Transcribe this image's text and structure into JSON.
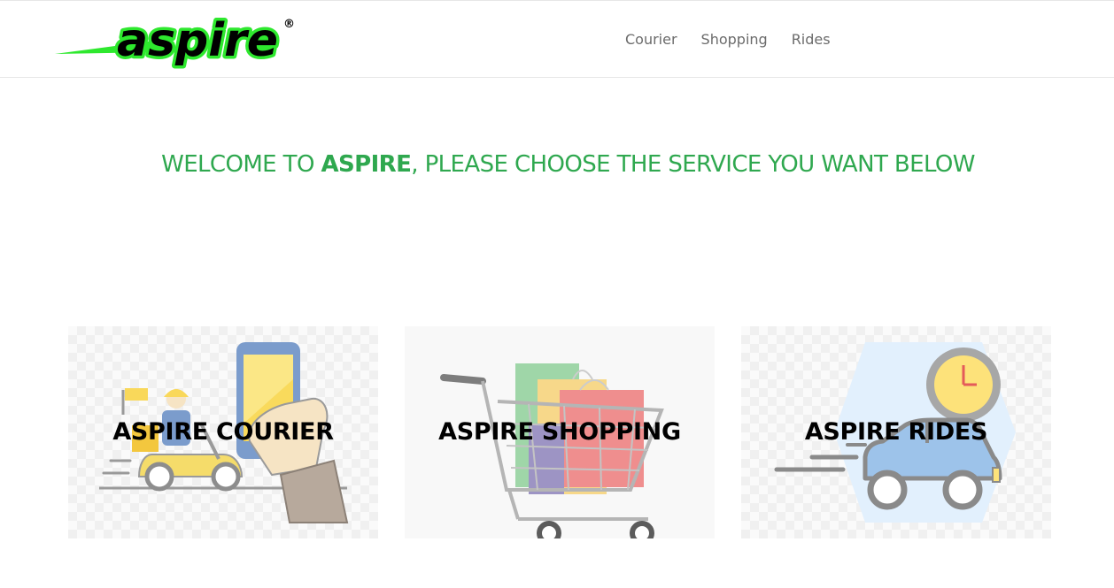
{
  "brand": {
    "logo_text": "aspire",
    "registered_mark": "®",
    "logo_color": "#000000",
    "accent_color": "#2ee82e"
  },
  "nav": {
    "items": [
      {
        "label": "Courier"
      },
      {
        "label": "Shopping"
      },
      {
        "label": "Rides"
      }
    ]
  },
  "welcome": {
    "prefix": "WELCOME TO ",
    "brand": "ASPIRE",
    "suffix": ", PLEASE CHOOSE THE SERVICE YOU WANT BELOW",
    "color": "#2fa84f"
  },
  "services": [
    {
      "title": "ASPIRE COURIER",
      "icon": "scooter-delivery-icon"
    },
    {
      "title": "ASPIRE SHOPPING",
      "icon": "shopping-cart-icon"
    },
    {
      "title": "ASPIRE RIDES",
      "icon": "car-clock-icon"
    }
  ]
}
